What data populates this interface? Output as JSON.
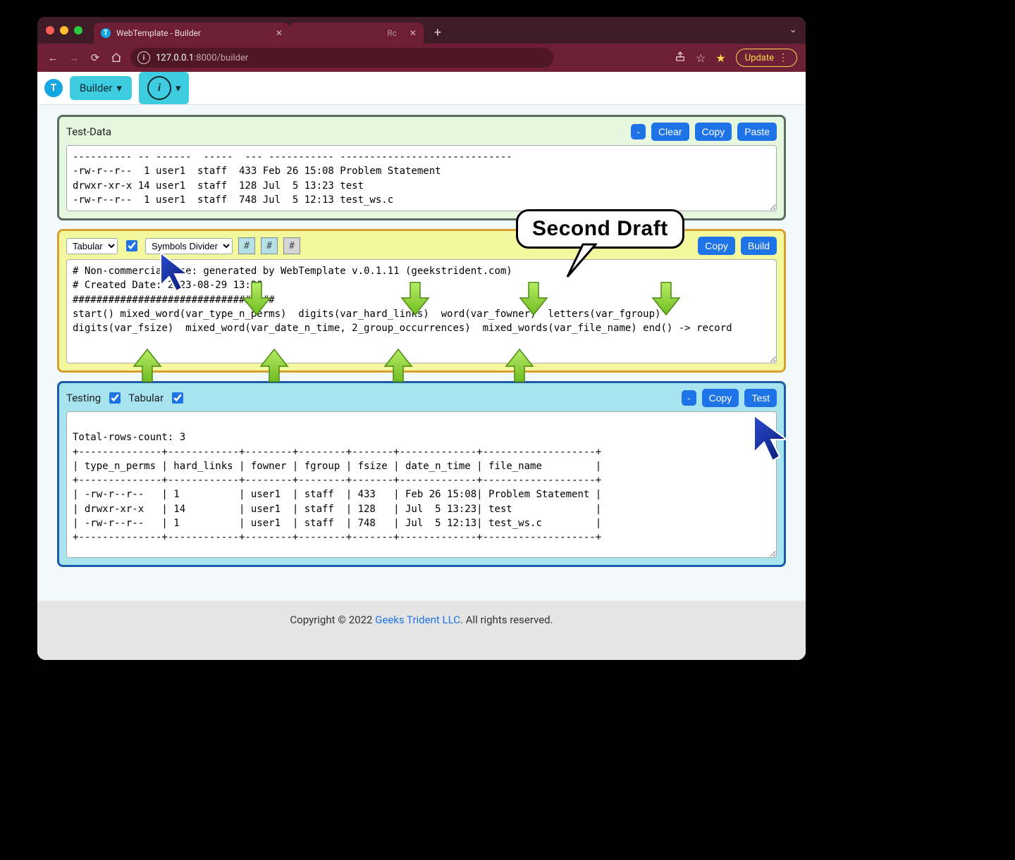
{
  "browser": {
    "tab_title": "WebTemplate - Builder",
    "hidden_tab_fragment": "Rc",
    "url_host": "127.0.0.1",
    "url_port_path": ":8000/builder",
    "update_label": "Update"
  },
  "toolbar": {
    "builder_label": "Builder"
  },
  "panel_testdata": {
    "title": "Test-Data",
    "btn_minus": "-",
    "btn_clear": "Clear",
    "btn_copy": "Copy",
    "btn_paste": "Paste",
    "content": "---------- -- ------  -----  --- ----------- -----------------------------\n-rw-r--r--  1 user1  staff  433 Feb 26 15:08 Problem Statement\ndrwxr-xr-x 14 user1  staff  128 Jul  5 13:23 test\n-rw-r--r--  1 user1  staff  748 Jul  5 12:13 test_ws.c"
  },
  "panel_builder": {
    "select1": "Tabular",
    "select2": "Symbols Divider",
    "hash": "#",
    "btn_copy": "Copy",
    "btn_build": "Build",
    "content": "# Non-commercial use: generated by WebTemplate v.0.1.11 (geekstrident.com)\n# Created Date: 2023-08-29 13:28\n##################################\nstart() mixed_word(var_type_n_perms)  digits(var_hard_links)  word(var_fowner)  letters(var_fgroup)  \ndigits(var_fsize)  mixed_word(var_date_n_time, 2_group_occurrences)  mixed_words(var_file_name) end() -> record"
  },
  "panel_testing": {
    "label_testing": "Testing",
    "label_tabular": "Tabular",
    "btn_minus": "-",
    "btn_copy": "Copy",
    "btn_test": "Test",
    "content": "\nTotal-rows-count: 3\n+--------------+------------+--------+--------+-------+-------------+-------------------+\n| type_n_perms | hard_links | fowner | fgroup | fsize | date_n_time | file_name         |\n+--------------+------------+--------+--------+-------+-------------+-------------------+\n| -rw-r--r--   | 1          | user1  | staff  | 433   | Feb 26 15:08| Problem Statement |\n| drwxr-xr-x   | 14         | user1  | staff  | 128   | Jul  5 13:23| test              |\n| -rw-r--r--   | 1          | user1  | staff  | 748   | Jul  5 12:13| test_ws.c         |\n+--------------+------------+--------+--------+-------+-------------+-------------------+"
  },
  "footer": {
    "pre": "Copyright © 2022 ",
    "link": "Geeks Trident LLC",
    "post": ". All rights reserved."
  },
  "callout": {
    "text": "Second Draft"
  },
  "chart_data": {
    "type": "table",
    "title": "Total-rows-count: 3",
    "columns": [
      "type_n_perms",
      "hard_links",
      "fowner",
      "fgroup",
      "fsize",
      "date_n_time",
      "file_name"
    ],
    "rows": [
      [
        "-rw-r--r--",
        "1",
        "user1",
        "staff",
        "433",
        "Feb 26 15:08",
        "Problem Statement"
      ],
      [
        "drwxr-xr-x",
        "14",
        "user1",
        "staff",
        "128",
        "Jul  5 13:23",
        "test"
      ],
      [
        "-rw-r--r--",
        "1",
        "user1",
        "staff",
        "748",
        "Jul  5 12:13",
        "test_ws.c"
      ]
    ]
  }
}
